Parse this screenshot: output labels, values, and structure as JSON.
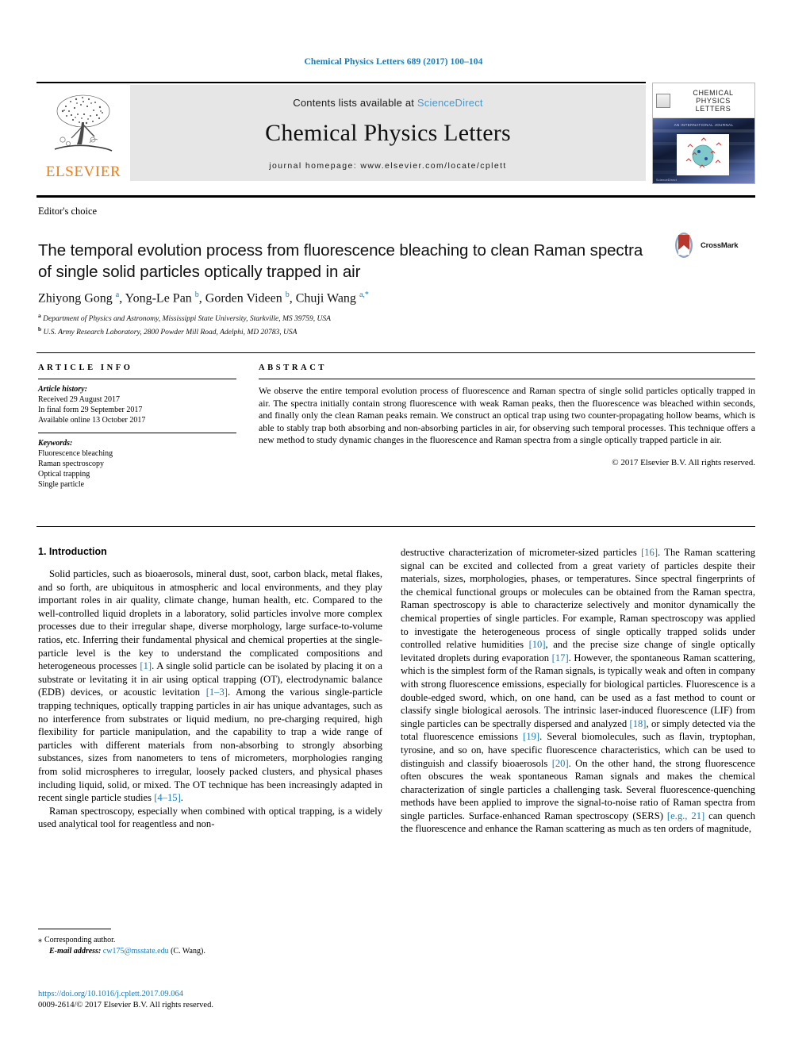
{
  "running_head": "Chemical Physics Letters 689 (2017) 100–104",
  "masthead": {
    "publisher": "ELSEVIER",
    "contents_prefix": "Contents lists available at ",
    "sciencedirect": "ScienceDirect",
    "journal_title": "Chemical Physics Letters",
    "homepage": "journal homepage: www.elsevier.com/locate/cplett",
    "cover": {
      "title_line1": "CHEMICAL",
      "title_line2": "PHYSICS",
      "title_line3": "LETTERS",
      "subtitle": "AN INTERNATIONAL JOURNAL",
      "footer": "ScienceDirect"
    }
  },
  "article": {
    "category": "Editor's choice",
    "title": "The temporal evolution process from fluorescence bleaching to clean Raman spectra of single solid particles optically trapped in air",
    "crossmark_label": "CrossMark",
    "authors_html": "Zhiyong Gong <sup>a</sup>, Yong-Le Pan <sup>b</sup>, Gorden Videen <sup>b</sup>, Chuji Wang <sup>a,*</sup>",
    "affiliation_a": "Department of Physics and Astronomy, Mississippi State University, Starkville, MS 39759, USA",
    "affiliation_b": "U.S. Army Research Laboratory, 2800 Powder Mill Road, Adelphi, MD 20783, USA"
  },
  "article_info": {
    "label": "ARTICLE INFO",
    "history_label": "Article history:",
    "history": [
      "Received 29 August 2017",
      "In final form 29 September 2017",
      "Available online 13 October 2017"
    ],
    "keywords_label": "Keywords:",
    "keywords": [
      "Fluorescence bleaching",
      "Raman spectroscopy",
      "Optical trapping",
      "Single particle"
    ]
  },
  "abstract": {
    "label": "ABSTRACT",
    "text": "We observe the entire temporal evolution process of fluorescence and Raman spectra of single solid particles optically trapped in air. The spectra initially contain strong fluorescence with weak Raman peaks, then the fluorescence was bleached within seconds, and finally only the clean Raman peaks remain. We construct an optical trap using two counter-propagating hollow beams, which is able to stably trap both absorbing and non-absorbing particles in air, for observing such temporal processes. This technique offers a new method to study dynamic changes in the fluorescence and Raman spectra from a single optically trapped particle in air.",
    "copyright": "© 2017 Elsevier B.V. All rights reserved."
  },
  "body": {
    "section_heading": "1. Introduction",
    "left_paragraphs": [
      "Solid particles, such as bioaerosols, mineral dust, soot, carbon black, metal flakes, and so forth, are ubiquitous in atmospheric and local environments, and they play important roles in air quality, climate change, human health, etc. Compared to the well-controlled liquid droplets in a laboratory, solid particles involve more complex processes due to their irregular shape, diverse morphology, large surface-to-volume ratios, etc. Inferring their fundamental physical and chemical properties at the single-particle level is the key to understand the complicated compositions and heterogeneous processes [1]. A single solid particle can be isolated by placing it on a substrate or levitating it in air using optical trapping (OT), electrodynamic balance (EDB) devices, or acoustic levitation [1–3]. Among the various single-particle trapping techniques, optically trapping particles in air has unique advantages, such as no interference from substrates or liquid medium, no pre-charging required, high flexibility for particle manipulation, and the capability to trap a wide range of particles with different materials from non-absorbing to strongly absorbing substances, sizes from nanometers to tens of micrometers, morphologies ranging from solid microspheres to irregular, loosely packed clusters, and physical phases including liquid, solid, or mixed. The OT technique has been increasingly adapted in recent single particle studies [4–15].",
      "Raman spectroscopy, especially when combined with optical trapping, is a widely used analytical tool for reagentless and non-"
    ],
    "right_paragraphs": [
      "destructive characterization of micrometer-sized particles [16]. The Raman scattering signal can be excited and collected from a great variety of particles despite their materials, sizes, morphologies, phases, or temperatures. Since spectral fingerprints of the chemical functional groups or molecules can be obtained from the Raman spectra, Raman spectroscopy is able to characterize selectively and monitor dynamically the chemical properties of single particles. For example, Raman spectroscopy was applied to investigate the heterogeneous process of single optically trapped solids under controlled relative humidities [10], and the precise size change of single optically levitated droplets during evaporation [17]. However, the spontaneous Raman scattering, which is the simplest form of the Raman signals, is typically weak and often in company with strong fluorescence emissions, especially for biological particles. Fluorescence is a double-edged sword, which, on one hand, can be used as a fast method to count or classify single biological aerosols. The intrinsic laser-induced fluorescence (LIF) from single particles can be spectrally dispersed and analyzed [18], or simply detected via the total fluorescence emissions [19]. Several biomolecules, such as flavin, tryptophan, tyrosine, and so on, have specific fluorescence characteristics, which can be used to distinguish and classify bioaerosols [20]. On the other hand, the strong fluorescence often obscures the weak spontaneous Raman signals and makes the chemical characterization of single particles a challenging task. Several fluorescence-quenching methods have been applied to improve the signal-to-noise ratio of Raman spectra from single particles. Surface-enhanced Raman spectroscopy (SERS) [e.g., 21] can quench the fluorescence and enhance the Raman scattering as much as ten orders of magnitude,"
    ]
  },
  "footer": {
    "corresponding_marker": "⁎",
    "corresponding_text": "Corresponding author.",
    "email_label": "E-mail address:",
    "email": "cw175@msstate.edu",
    "email_suffix": "(C. Wang).",
    "doi": "https://doi.org/10.1016/j.cplett.2017.09.064",
    "issn_line": "0009-2614/© 2017 Elsevier B.V. All rights reserved."
  },
  "colors": {
    "link_blue": "#1a7bb9",
    "sciencedirect_blue": "#3e9bd4",
    "elsevier_orange": "#ef7d1a",
    "masthead_grey": "#e6e6e6"
  }
}
